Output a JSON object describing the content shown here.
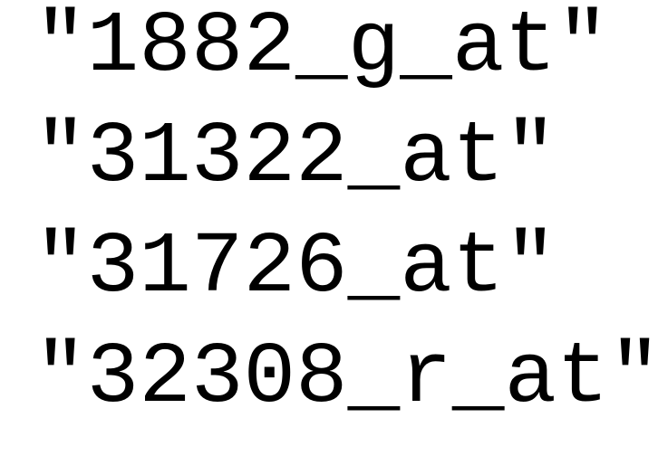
{
  "lines": [
    "\"1882_g_at\"",
    "\"31322_at\"",
    "\"31726_at\"",
    "\"32308_r_at\""
  ]
}
